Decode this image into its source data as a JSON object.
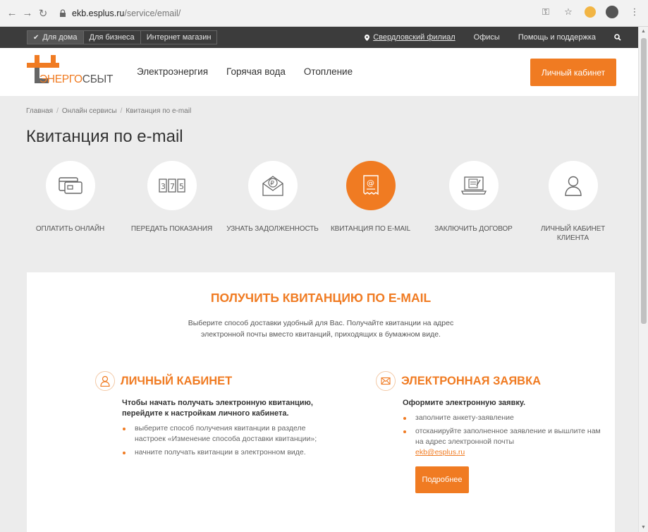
{
  "browser": {
    "url_host": "ekb.esplus.ru",
    "url_path": "/service/email/"
  },
  "topbar": {
    "segments": [
      "Для дома",
      "Для бизнеса",
      "Интернет магазин"
    ],
    "branch": "Свердловский филиал",
    "offices": "Офисы",
    "help": "Помощь и поддержка"
  },
  "header": {
    "logo_part1": "ЭНЕРГО",
    "logo_part2": "СБЫТ",
    "nav": [
      "Электроэнергия",
      "Горячая вода",
      "Отопление"
    ],
    "cabinet_button": "Личный кабинет"
  },
  "breadcrumb": [
    "Главная",
    "Онлайн сервисы",
    "Квитанция по e-mail"
  ],
  "page_title": "Квитанция по e-mail",
  "services": [
    {
      "label": "ОПЛАТИТЬ ОНЛАЙН",
      "icon": "card-icon"
    },
    {
      "label": "ПЕРЕДАТЬ ПОКАЗАНИЯ",
      "icon": "meter-icon"
    },
    {
      "label": "УЗНАТЬ ЗАДОЛЖЕННОСТЬ",
      "icon": "ruble-envelope-icon"
    },
    {
      "label": "КВИТАНЦИЯ ПО E-MAIL",
      "icon": "email-receipt-icon"
    },
    {
      "label": "ЗАКЛЮЧИТЬ ДОГОВОР",
      "icon": "laptop-contract-icon"
    },
    {
      "label": "ЛИЧНЫЙ КАБИНЕТ КЛИЕНТА",
      "icon": "user-icon"
    }
  ],
  "card": {
    "title": "ПОЛУЧИТЬ КВИТАНЦИЮ ПО E-MAIL",
    "subtitle": "Выберите способ доставки удобный для Вас. Получайте квитанции на адрес электронной почты вместо квитанций, приходящих в бумажном виде.",
    "left": {
      "title": "ЛИЧНЫЙ КАБИНЕТ",
      "lead": "Чтобы начать получать электронную квитанцию, перейдите к настройкам личного кабинета.",
      "items": [
        "выберите способ получения квитанции в разделе настроек «Изменение способа доставки квитанции»;",
        "начните получать квитанции в электронном виде."
      ]
    },
    "right": {
      "title": "ЭЛЕКТРОННАЯ ЗАЯВКА",
      "lead": "Оформите электронную заявку.",
      "items": [
        "заполните анкету-заявление",
        "отсканируйте заполненное заявление и вышлите нам на адрес электронной почты"
      ],
      "email": "ekb@esplus.ru",
      "more_button": "Подробнее"
    }
  },
  "colors": {
    "accent": "#f07b22",
    "topbar": "#3c3c3c",
    "background": "#ececec"
  }
}
